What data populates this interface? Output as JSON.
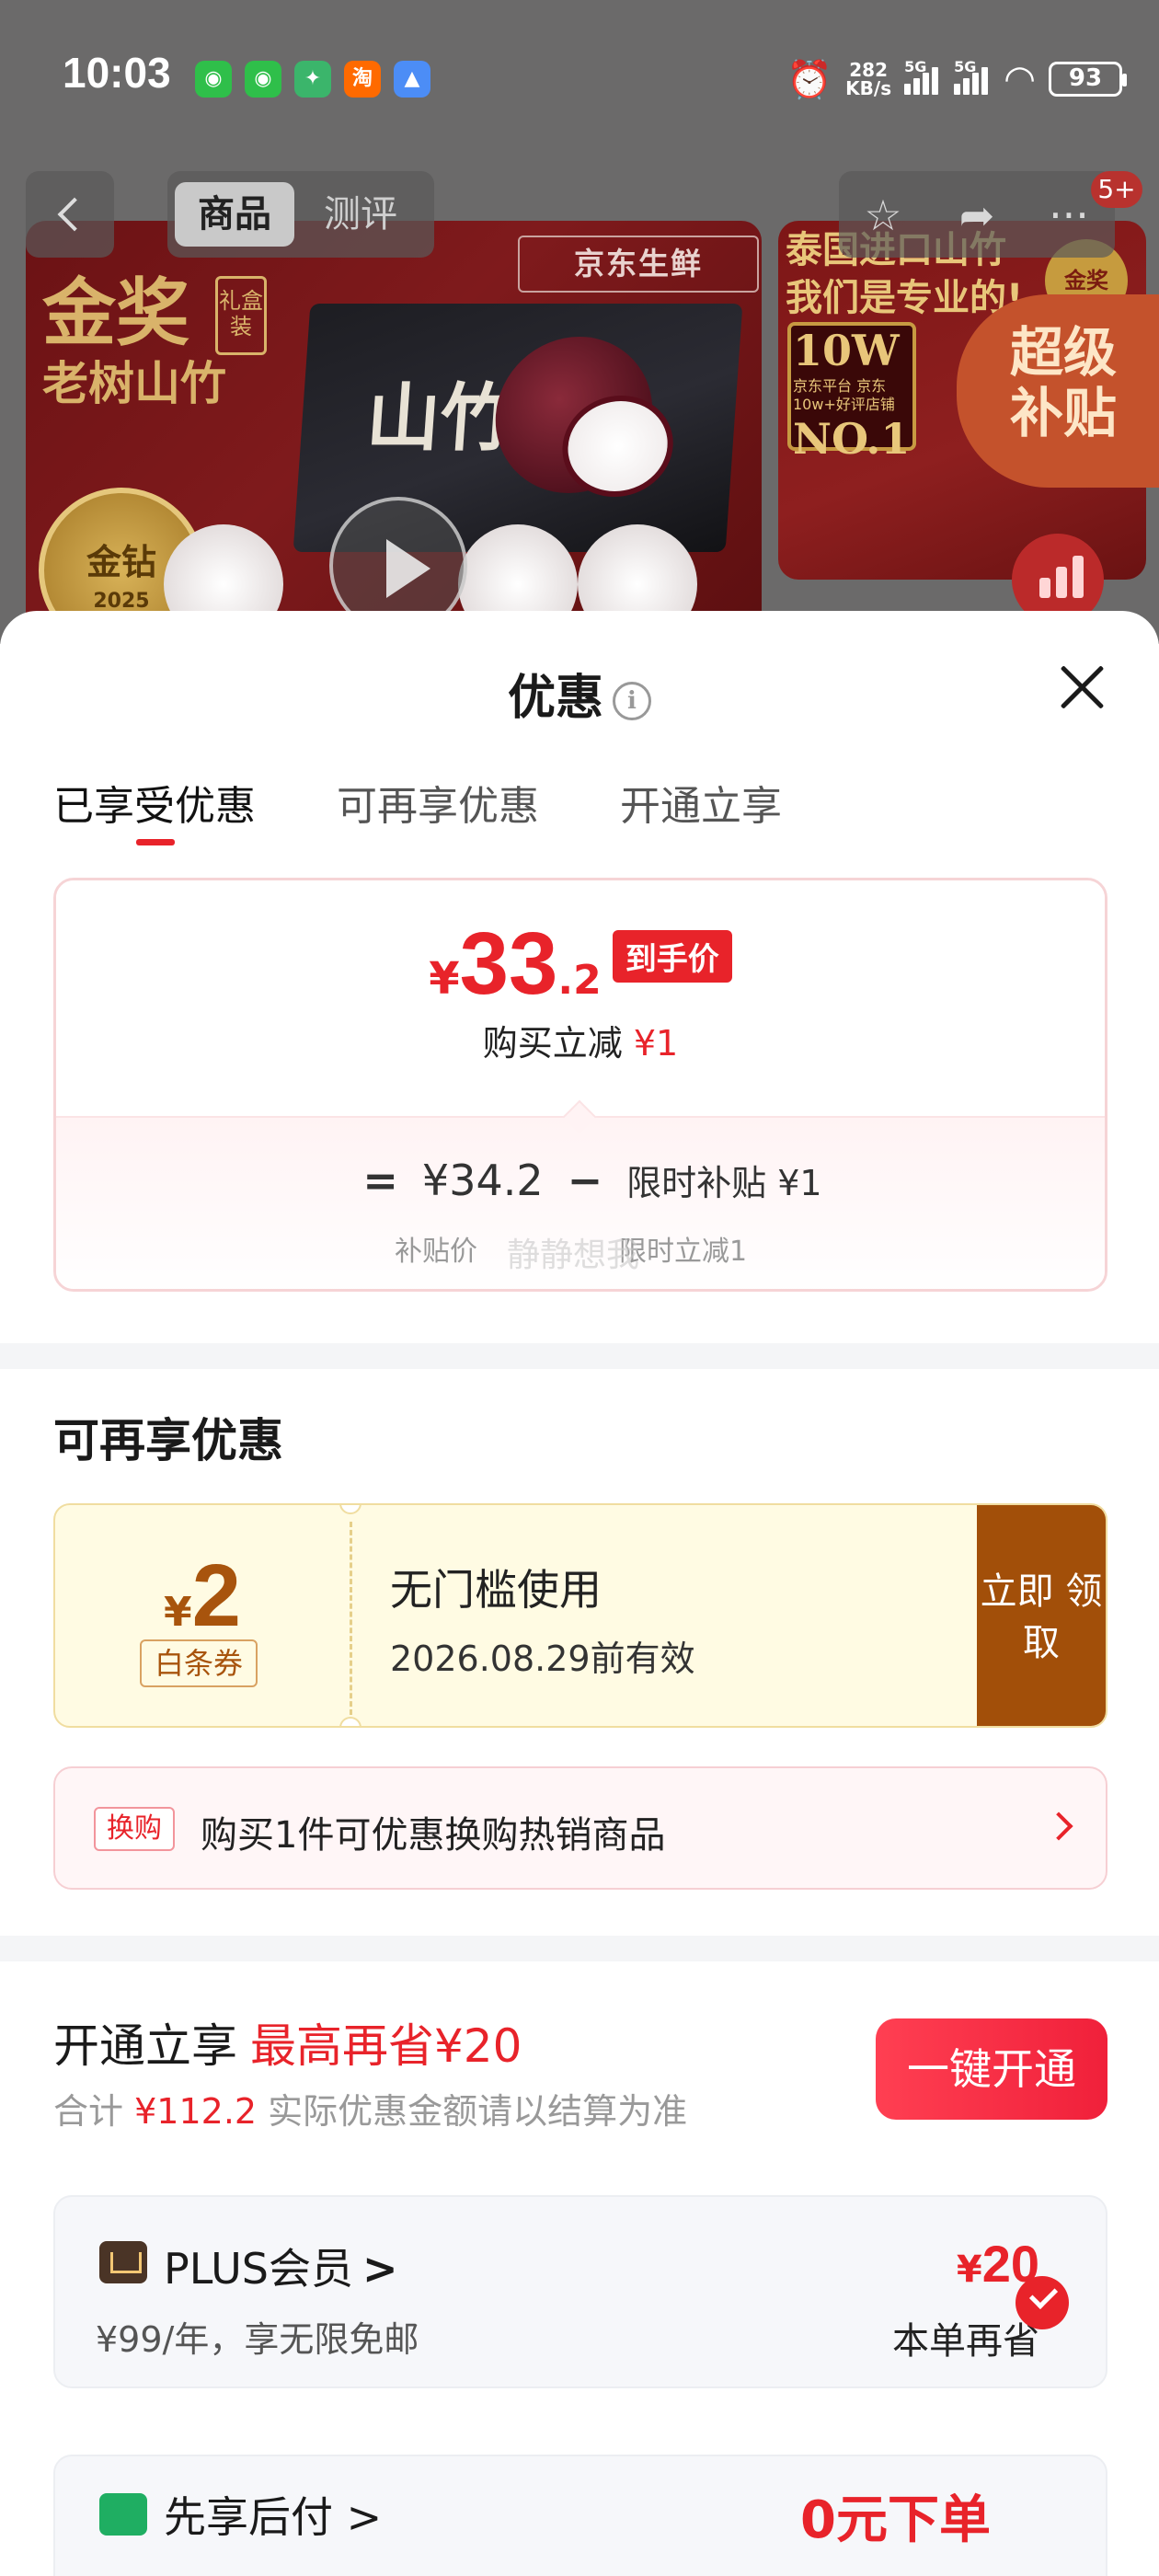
{
  "status_bar": {
    "time": "10:03",
    "apps": [
      "wechat-icon",
      "wechat-icon",
      "game-icon",
      "taobao-icon",
      "app-icon"
    ],
    "taobao_glyph": "淘",
    "net_speed_value": "282",
    "net_speed_unit": "KB/s",
    "sig1_label": "5G",
    "sig2_label": "5G",
    "battery": "93"
  },
  "top_nav": {
    "tab_active": "商品",
    "tab_other": "测评",
    "badge": "5+"
  },
  "background_banner": {
    "brand": "京东生鲜",
    "title_line1": "金奖",
    "title_line2": "老树山竹",
    "giftbox": "礼盒装",
    "seal_main": "金钻",
    "seal_year": "2025",
    "box_label": "山竹",
    "right_title": "泰国进口山竹 我们是专业的!",
    "right_big1": "10W",
    "right_sub": "京东平台 京东10w+好评店铺",
    "right_big2": "NO.1",
    "right_seal": "金奖",
    "super_subsidy": "超级 补贴"
  },
  "sheet": {
    "title": "优惠",
    "info_glyph": "i",
    "tabs": [
      "已享受优惠",
      "可再享优惠",
      "开通立享"
    ],
    "final_price": {
      "currency": "¥",
      "integer": "33",
      "decimal": ".2",
      "tag": "到手价"
    },
    "instant_off_label": "购买立减",
    "instant_off_value": "¥1",
    "formula": {
      "eq": "=",
      "price": "¥34.2",
      "minus": "−",
      "discount": "限时补贴 ¥1",
      "price_caption": "补贴价",
      "discount_caption": "限时立减1"
    },
    "watermark": "静静想我",
    "more_title": "可再享优惠",
    "coupon": {
      "currency": "¥",
      "amount": "2",
      "tag": "白条券",
      "name": "无门槛使用",
      "valid": "2026.08.29前有效",
      "button": "立即 领取"
    },
    "swap": {
      "tag": "换购",
      "text": "购买1件可优惠换购热销商品"
    },
    "open": {
      "title": "开通立享",
      "highlight": "最高再省¥20",
      "sub_prefix": "合计",
      "sub_total": "¥112.2",
      "sub_suffix": "实际优惠金额请以结算为准",
      "button": "一键开通"
    },
    "plus": {
      "name": "PLUS会员",
      "chevron": ">",
      "desc": "¥99/年，享无限免邮",
      "save_currency": "¥",
      "save_amount": "20",
      "save_caption": "本单再省"
    },
    "next_card": {
      "name": "先享后付 >",
      "value": "0元下单"
    }
  },
  "colors": {
    "accent_red": "#e8232a",
    "coupon_brown": "#a24f09",
    "coupon_bg": "#fffbe3"
  }
}
